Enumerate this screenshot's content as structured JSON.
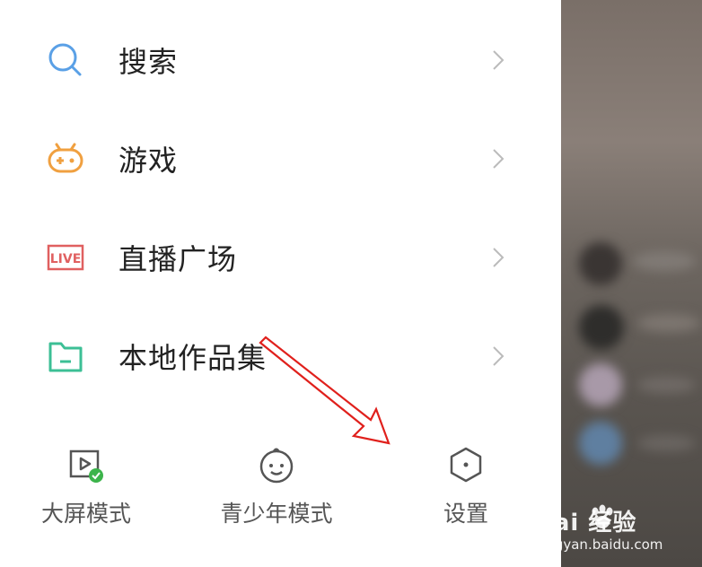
{
  "menu": {
    "items": [
      {
        "label": "搜索",
        "icon": "search-icon",
        "color": "#5aa0e6"
      },
      {
        "label": "游戏",
        "icon": "gamepad-icon",
        "color": "#f0a040"
      },
      {
        "label": "直播广场",
        "icon": "live-icon",
        "color": "#e06060",
        "icon_text": "LIVE"
      },
      {
        "label": "本地作品集",
        "icon": "folder-icon",
        "color": "#3cbf95"
      }
    ]
  },
  "bottom": {
    "items": [
      {
        "label": "大屏模式",
        "icon": "big-screen-icon"
      },
      {
        "label": "青少年模式",
        "icon": "child-face-icon"
      },
      {
        "label": "设置",
        "icon": "hexagon-settings-icon"
      }
    ]
  },
  "watermark": {
    "brand": "Bai 经验",
    "url": "jingyan.baidu.com"
  }
}
